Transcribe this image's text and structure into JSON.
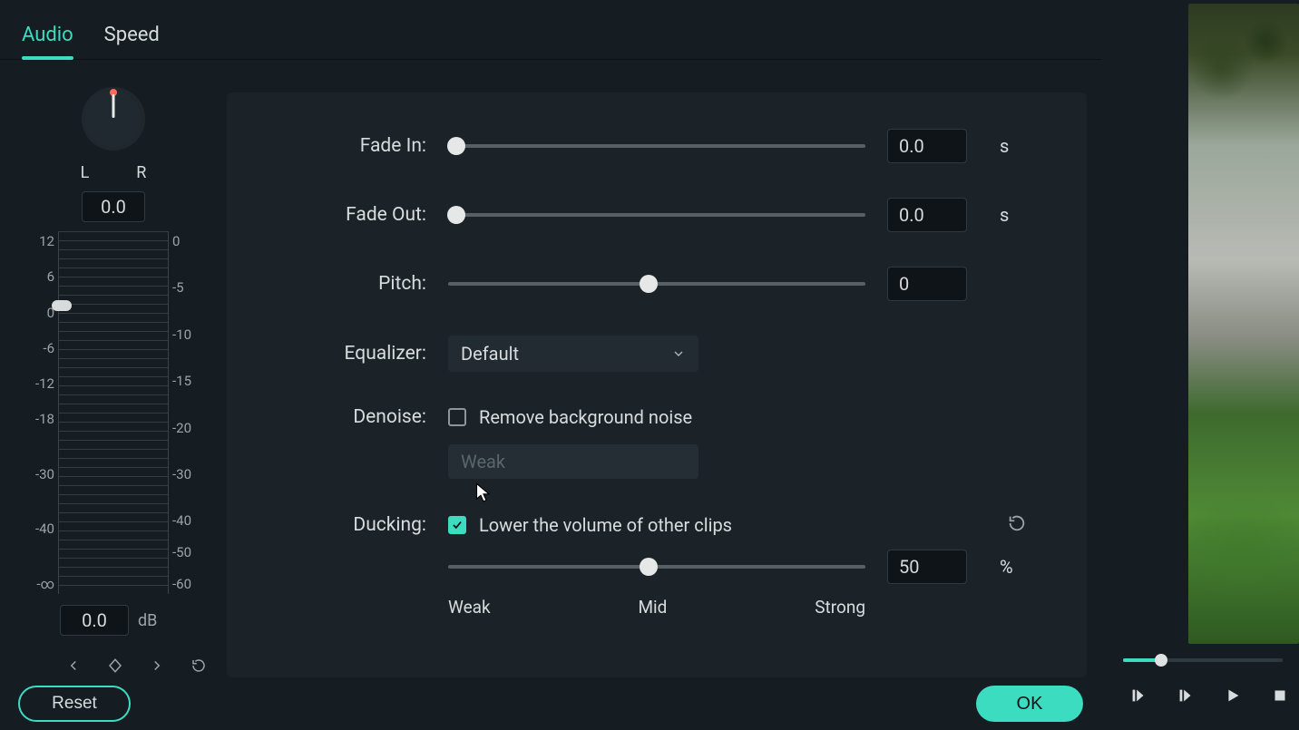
{
  "tabs": {
    "audio": "Audio",
    "speed": "Speed"
  },
  "pan": {
    "left": "L",
    "right": "R",
    "value": "0.0"
  },
  "left_scale": [
    "12",
    "6",
    "0",
    "-6",
    "-12",
    "-18",
    "",
    "-30",
    "",
    "-40",
    "",
    "-∞"
  ],
  "right_scale": [
    "0",
    "",
    "-5",
    "",
    "-10",
    "",
    "-15",
    "",
    "-20",
    "",
    "-30",
    "",
    "-40",
    "-50",
    "-60"
  ],
  "db": {
    "value": "0.0",
    "unit": "dB"
  },
  "fade_in": {
    "label": "Fade In:",
    "value": "0.0",
    "unit": "s"
  },
  "fade_out": {
    "label": "Fade Out:",
    "value": "0.0",
    "unit": "s"
  },
  "pitch": {
    "label": "Pitch:",
    "value": "0"
  },
  "equalizer": {
    "label": "Equalizer:",
    "selected": "Default"
  },
  "denoise": {
    "label": "Denoise:",
    "checkbox_label": "Remove background noise",
    "strength": "Weak"
  },
  "ducking": {
    "label": "Ducking:",
    "checkbox_label": "Lower the volume of other clips",
    "value": "50",
    "unit": "%",
    "weak": "Weak",
    "mid": "Mid",
    "strong": "Strong"
  },
  "footer": {
    "reset": "Reset",
    "ok": "OK"
  }
}
